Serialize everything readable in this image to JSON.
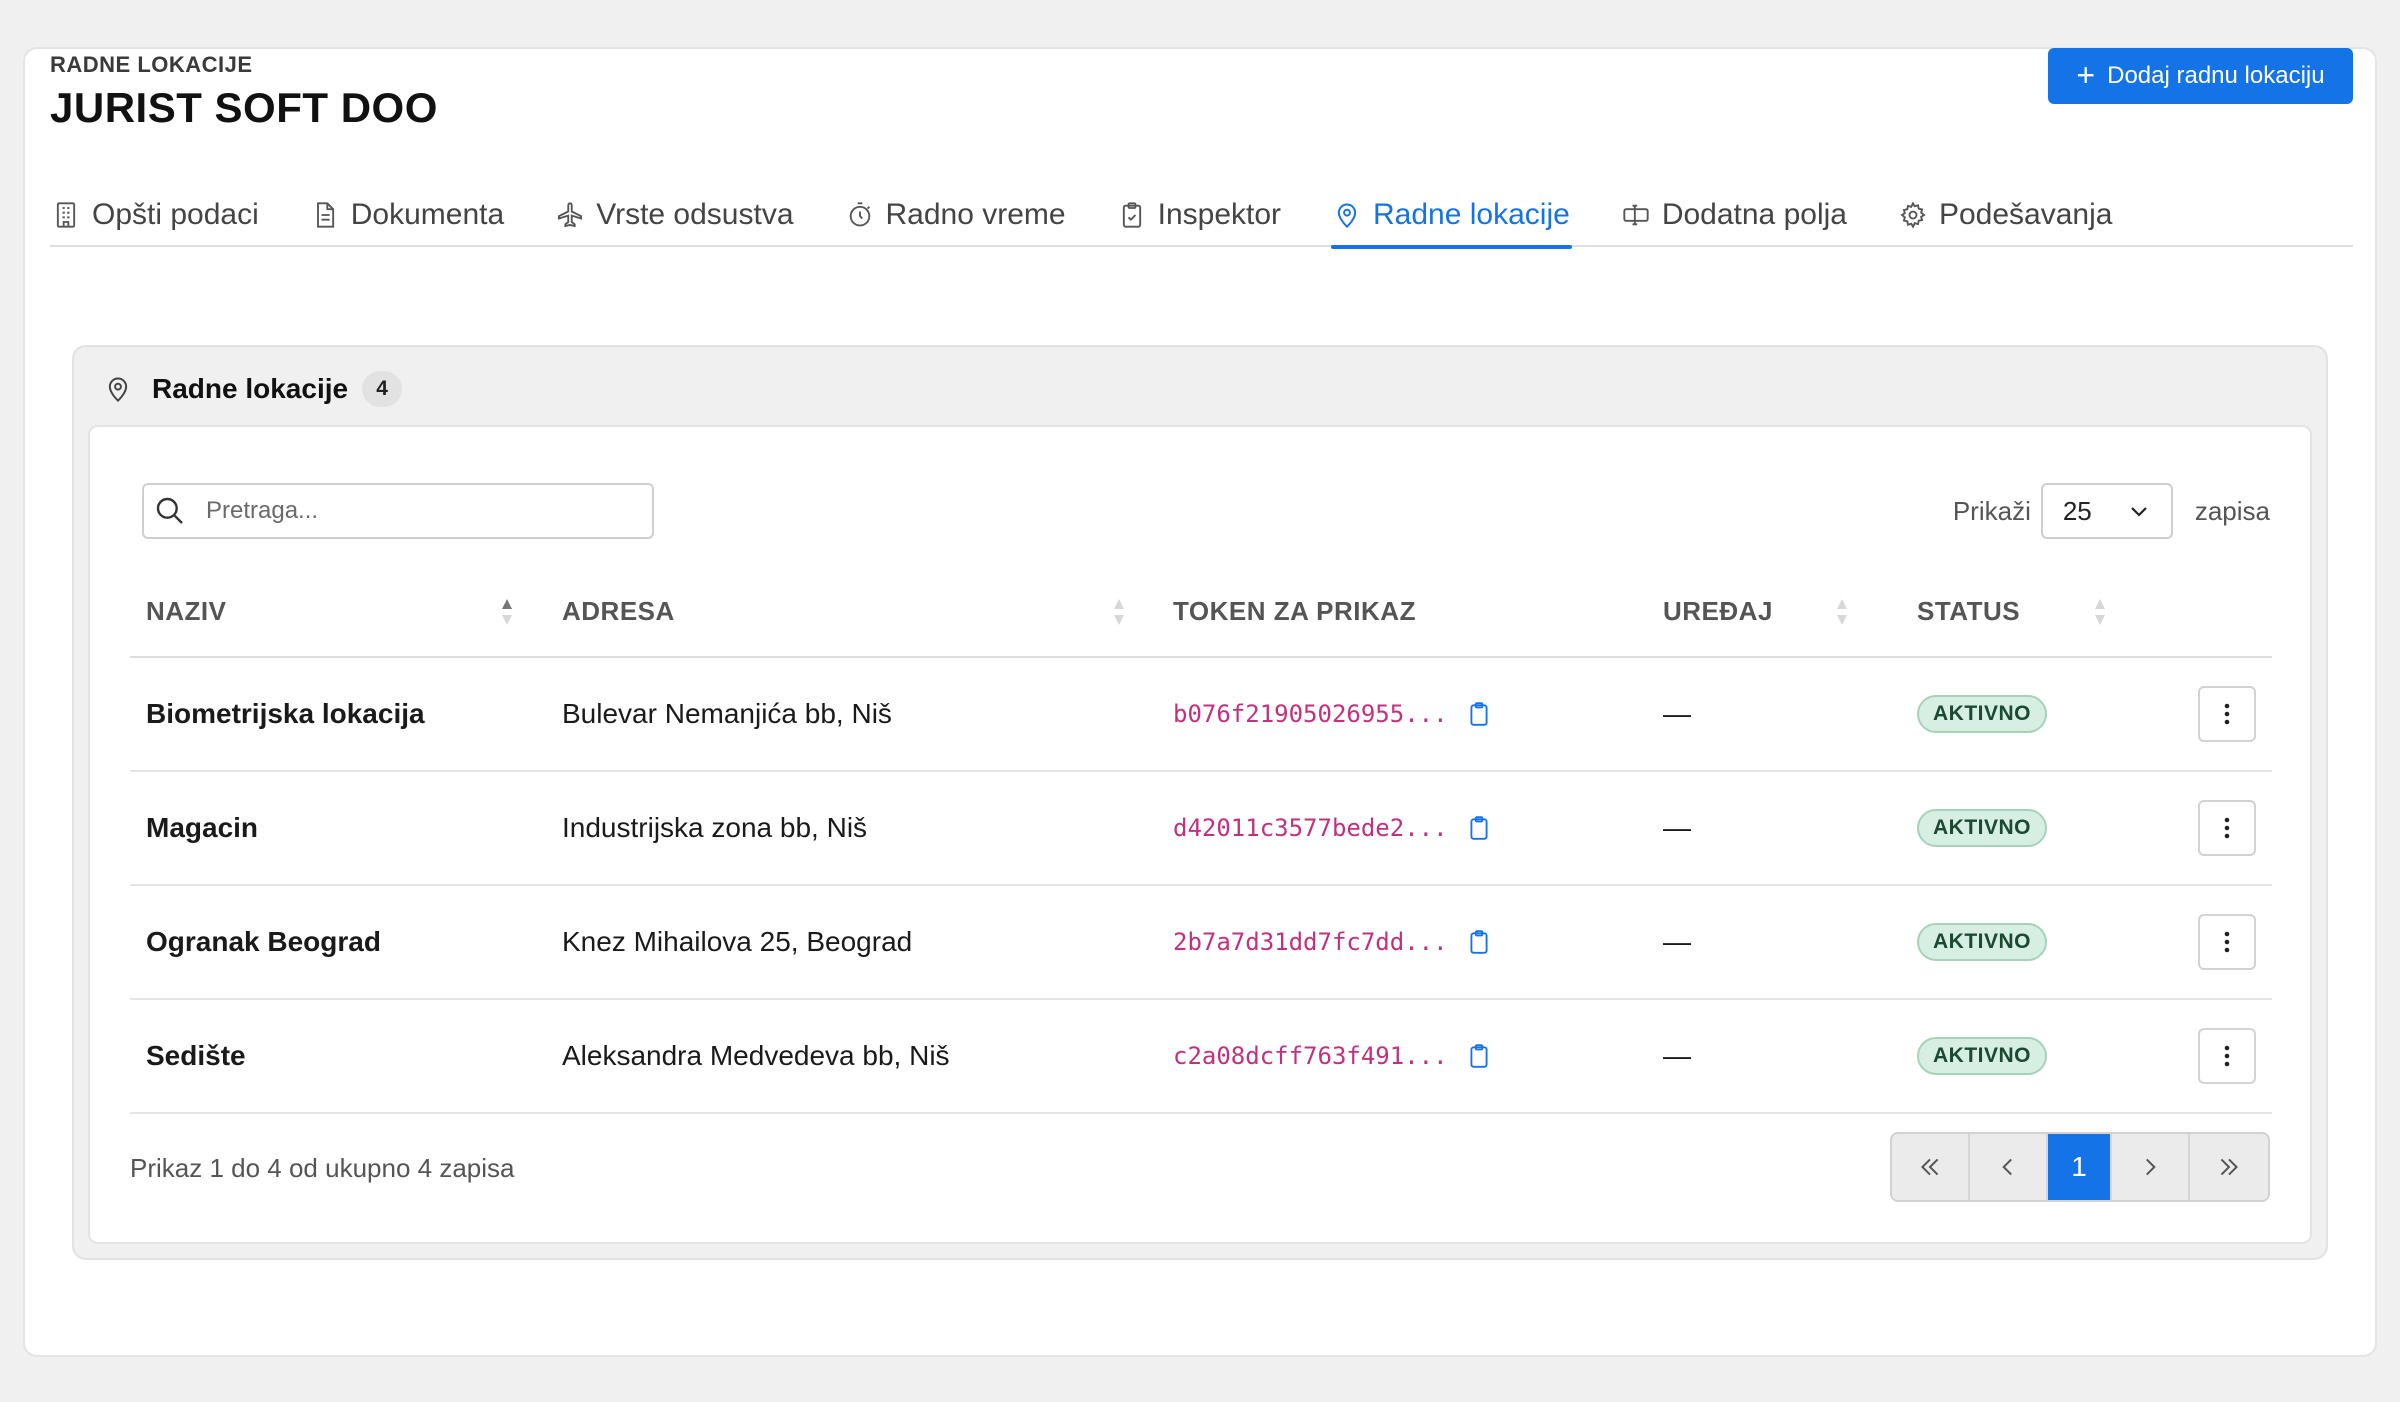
{
  "header": {
    "subtitle": "RADNE LOKACIJE",
    "title": "JURIST SOFT DOO",
    "add_button_label": "Dodaj radnu lokaciju"
  },
  "tabs": [
    {
      "label": "Opšti podaci",
      "icon": "building-icon"
    },
    {
      "label": "Dokumenta",
      "icon": "document-icon"
    },
    {
      "label": "Vrste odsustva",
      "icon": "plane-icon"
    },
    {
      "label": "Radno vreme",
      "icon": "stopwatch-icon"
    },
    {
      "label": "Inspektor",
      "icon": "clipboard-check-icon"
    },
    {
      "label": "Radne lokacije",
      "icon": "map-pin-icon",
      "active": true
    },
    {
      "label": "Dodatna polja",
      "icon": "input-field-icon"
    },
    {
      "label": "Podešavanja",
      "icon": "gear-icon"
    }
  ],
  "panel": {
    "title": "Radne lokacije",
    "count": "4"
  },
  "search": {
    "placeholder": "Pretraga..."
  },
  "page_size": {
    "prefix": "Prikaži",
    "value": "25",
    "suffix": "zapisa"
  },
  "table": {
    "columns": [
      "NAZIV",
      "ADRESA",
      "TOKEN ZA PRIKAZ",
      "UREĐAJ",
      "STATUS"
    ],
    "rows": [
      {
        "name": "Biometrijska lokacija",
        "address": "Bulevar Nemanjića bb, Niš",
        "token": "b076f21905026955...",
        "device": "—",
        "status": "AKTIVNO"
      },
      {
        "name": "Magacin",
        "address": "Industrijska zona bb, Niš",
        "token": "d42011c3577bede2...",
        "device": "—",
        "status": "AKTIVNO"
      },
      {
        "name": "Ogranak Beograd",
        "address": "Knez Mihailova 25, Beograd",
        "token": "2b7a7d31dd7fc7dd...",
        "device": "—",
        "status": "AKTIVNO"
      },
      {
        "name": "Sedište",
        "address": "Aleksandra Medvedeva bb, Niš",
        "token": "c2a08dcff763f491...",
        "device": "—",
        "status": "AKTIVNO"
      }
    ]
  },
  "footer": {
    "summary": "Prikaz 1 do 4 od ukupno 4 zapisa",
    "current_page": "1"
  },
  "colors": {
    "primary": "#1473e6",
    "token_text": "#c2307e",
    "status_bg": "#d7efe2"
  }
}
